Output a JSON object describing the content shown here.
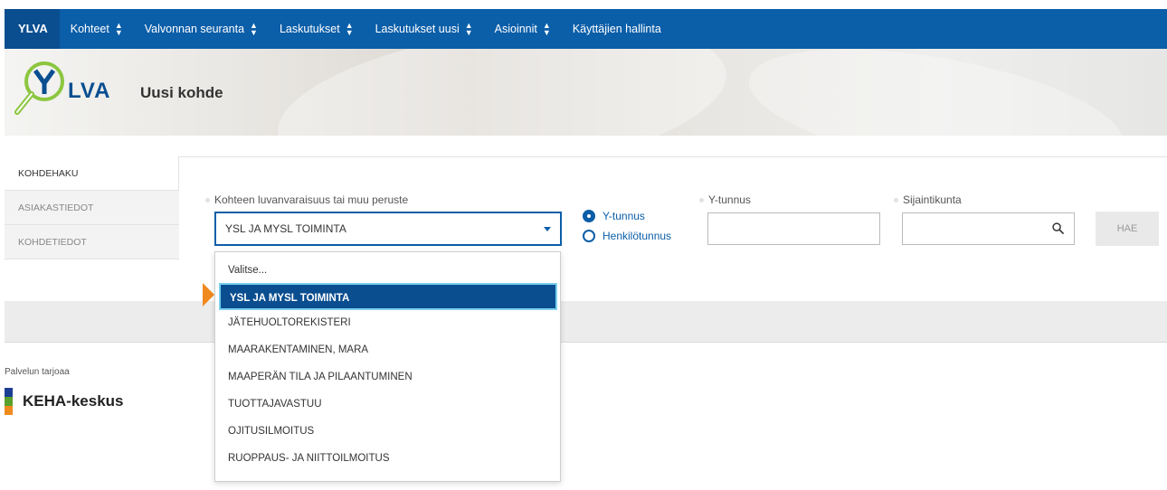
{
  "nav": {
    "brand": "YLVA",
    "items": [
      {
        "label": "Kohteet",
        "caret": true
      },
      {
        "label": "Valvonnan seuranta",
        "caret": true
      },
      {
        "label": "Laskutukset",
        "caret": true
      },
      {
        "label": "Laskutukset uusi",
        "caret": true
      },
      {
        "label": "Asioinnit",
        "caret": true
      },
      {
        "label": "Käyttäjien hallinta",
        "caret": false
      }
    ]
  },
  "header": {
    "logo_text": "LVA",
    "title": "Uusi kohde"
  },
  "sidebar": {
    "tabs": [
      {
        "label": "KOHDEHAKU",
        "active": true
      },
      {
        "label": "ASIAKASTIEDOT",
        "active": false
      },
      {
        "label": "KOHDETIEDOT",
        "active": false
      }
    ]
  },
  "form": {
    "basis_label": "Kohteen luvanvaraisuus tai muu peruste",
    "basis_value": "YSL JA MYSL TOIMINTA",
    "id_type": {
      "options": [
        "Y-tunnus",
        "Henkilötunnus"
      ],
      "selected": "Y-tunnus"
    },
    "ytunnus_label": "Y-tunnus",
    "ytunnus_value": "",
    "municipality_label": "Sijaintikunta",
    "municipality_value": "",
    "search_button": "HAE"
  },
  "dropdown": {
    "selected_index": 1,
    "options": [
      "Valitse...",
      "YSL JA MYSL TOIMINTA",
      "JÄTEHUOLTOREKISTERI",
      "MAARAKENTAMINEN, MARA",
      "MAAPERÄN TILA JA PILAANTUMINEN",
      "TUOTTAJAVASTUU",
      "OJITUSILMOITUS",
      "RUOPPAUS- JA NIITTOILMOITUS"
    ]
  },
  "footer": {
    "provider_label": "Palvelun tarjoaa",
    "provider_name": "KEHA-keskus"
  },
  "colors": {
    "primary": "#0b5ea8",
    "brand_dark": "#0a4e90",
    "selected_border": "#7bd0ef",
    "pointer": "#f08a1e",
    "logo_green": "#8cc63f",
    "keha_blue": "#1c3f94",
    "keha_green": "#5aa02c",
    "keha_orange": "#f08a1e"
  }
}
